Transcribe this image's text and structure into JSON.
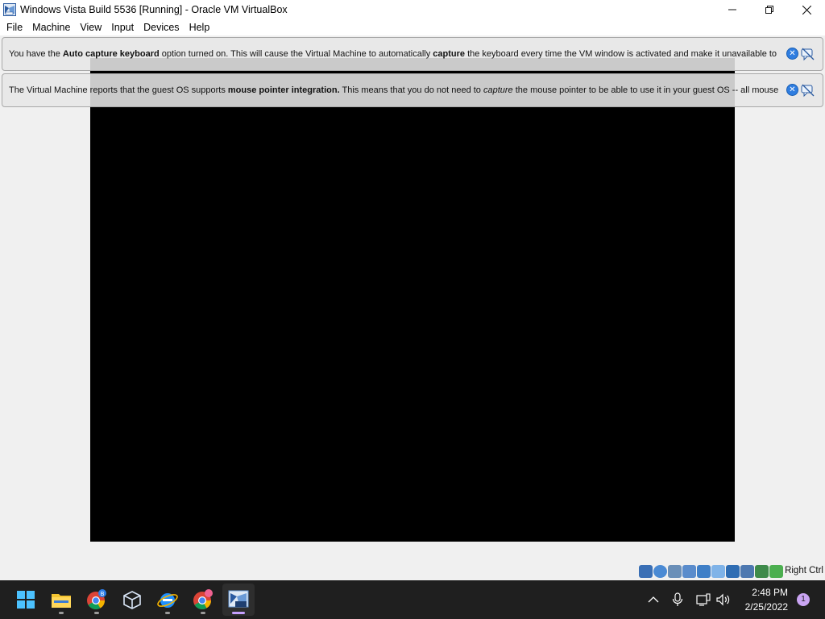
{
  "window": {
    "title": "Windows Vista Build 5536 [Running] - Oracle VM VirtualBox",
    "icon": "virtualbox-icon"
  },
  "menu": {
    "items": [
      "File",
      "Machine",
      "View",
      "Input",
      "Devices",
      "Help"
    ]
  },
  "banners": [
    {
      "parts": [
        {
          "t": "You have the ",
          "s": "normal"
        },
        {
          "t": "Auto capture keyboard",
          "s": "bold"
        },
        {
          "t": " option turned on. This will cause the Virtual Machine to automatically ",
          "s": "normal"
        },
        {
          "t": "capture",
          "s": "bold"
        },
        {
          "t": " the keyboard every time the VM window is activated and make it unavailable to",
          "s": "normal"
        }
      ]
    },
    {
      "parts": [
        {
          "t": "The Virtual Machine reports that the guest OS supports ",
          "s": "normal"
        },
        {
          "t": "mouse pointer integration.",
          "s": "bold"
        },
        {
          "t": " This means that you do not need to ",
          "s": "normal"
        },
        {
          "t": "capture",
          "s": "italic"
        },
        {
          "t": " the mouse pointer to be able to use it in your guest OS -- all mouse",
          "s": "normal"
        }
      ]
    }
  ],
  "statusbar": {
    "host_key": "Right Ctrl",
    "icons": [
      "hard-disk-icon",
      "optical-drive-icon",
      "audio-icon",
      "network-icon",
      "usb-icon",
      "shared-folders-icon",
      "display-icon",
      "video-capture-icon",
      "mouse-integration-icon",
      "keyboard-icon"
    ]
  },
  "taskbar": {
    "apps": [
      {
        "name": "start-button",
        "icon": "windows-logo-icon"
      },
      {
        "name": "file-explorer",
        "icon": "folder-icon"
      },
      {
        "name": "chrome-b",
        "icon": "chrome-icon",
        "badge": "B"
      },
      {
        "name": "virtualbox-manager",
        "icon": "cube-icon"
      },
      {
        "name": "ie-browser",
        "icon": "ie-icon"
      },
      {
        "name": "chrome-profile",
        "icon": "chrome-icon"
      },
      {
        "name": "vm-window",
        "icon": "virtualbox-vm-icon",
        "active": true
      }
    ],
    "time": "2:48 PM",
    "date": "2/25/2022",
    "notifications": "1"
  },
  "colors": {
    "taskbar": "#1f1f1f",
    "vm_screen": "#000000",
    "accent": "#c6a0ff"
  }
}
